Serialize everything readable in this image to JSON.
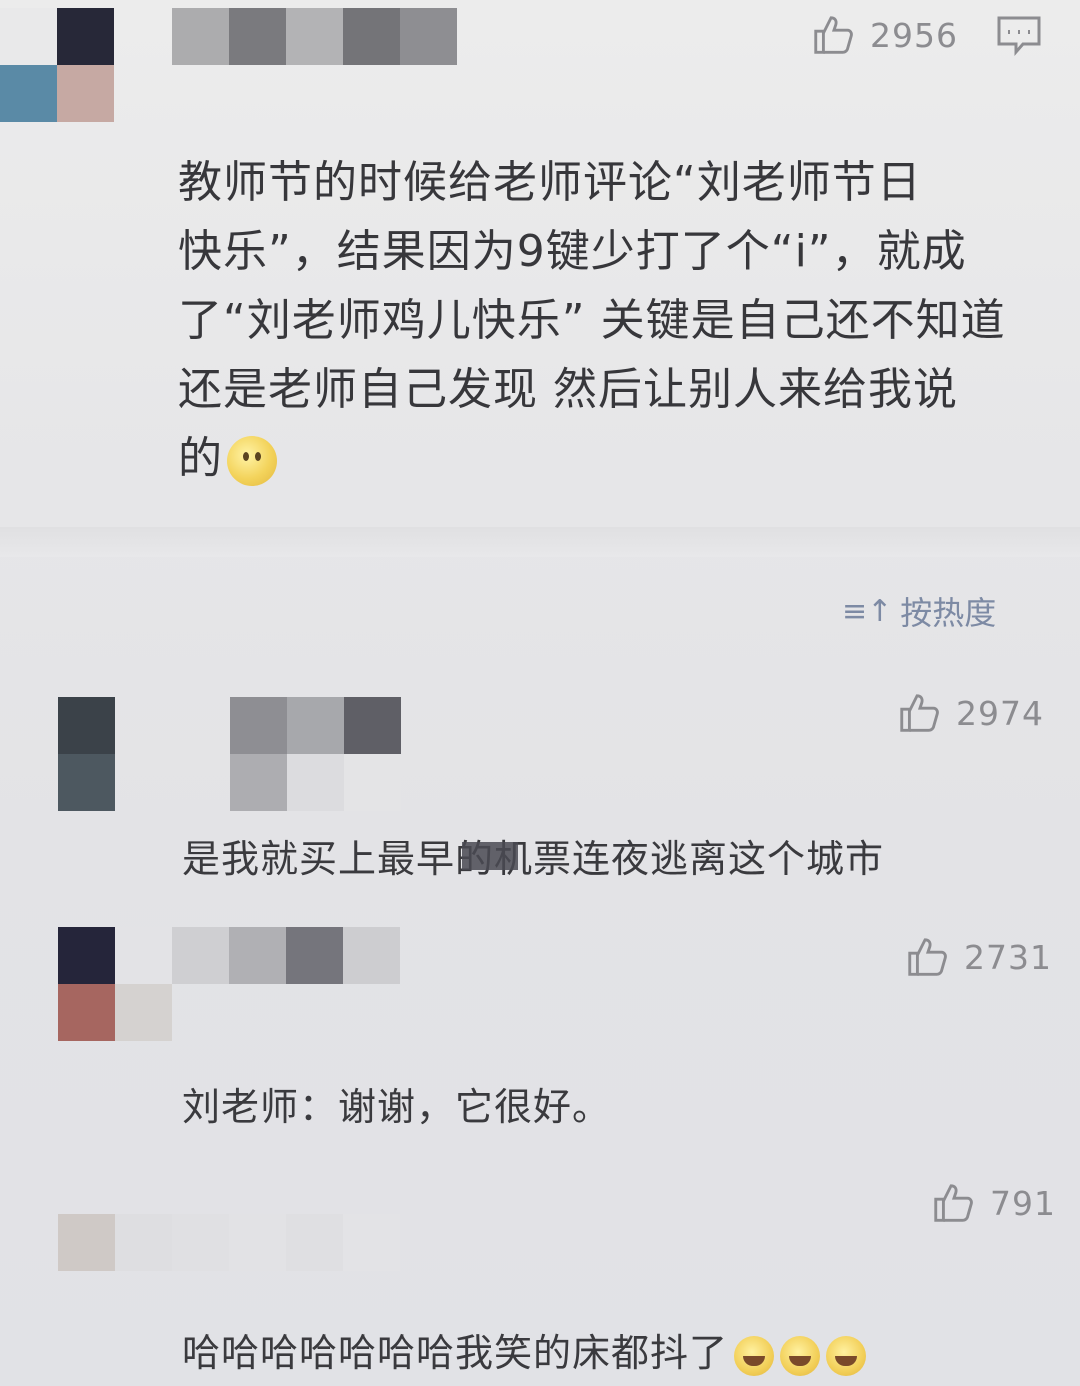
{
  "top_comment": {
    "likes": "2956",
    "text_lines": [
      "教师节的时候给老师评论“刘老师节日",
      "快乐”，结果因为9键少打了个“i”，就成",
      "了“刘老师鸡儿快乐” 关键是自己还不知道",
      "还是老师自己发现 然后让别人来给我说",
      "的"
    ],
    "emoji": "smiling-face-emoji"
  },
  "sort": {
    "label": "按热度",
    "icon": "≡↑"
  },
  "replies": [
    {
      "likes": "2974",
      "text": "是我就买上最早的机票连夜逃离这个城市"
    },
    {
      "likes": "2731",
      "text": "刘老师：谢谢，它很好。"
    },
    {
      "likes": "791",
      "text": "哈哈哈哈哈哈哈我笑的床都抖了"
    }
  ],
  "colors": {
    "text": "#37373b",
    "muted": "#8c8c90",
    "sort_blue": "#7d8aa4",
    "background": "#e6e6e8"
  }
}
